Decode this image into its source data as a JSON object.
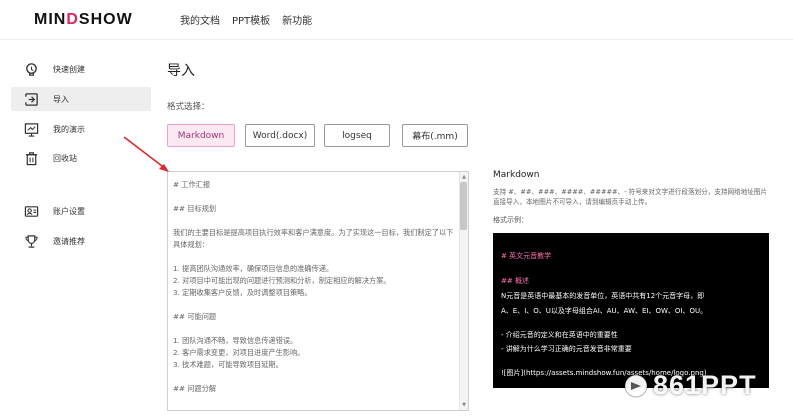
{
  "app": {
    "logo_prefix": "MIN",
    "logo_accent": "D",
    "logo_suffix": "SHOW",
    "accent_color": "#e0245e"
  },
  "topnav": {
    "items": [
      "我的文档",
      "PPT模板",
      "新功能"
    ]
  },
  "sidebar": {
    "items": [
      {
        "label": "快速创建",
        "icon": "lightbulb-icon"
      },
      {
        "label": "导入",
        "icon": "import-icon",
        "active": true
      },
      {
        "label": "我的演示",
        "icon": "presentation-icon"
      },
      {
        "label": "回收站",
        "icon": "trash-icon"
      },
      {
        "label": "账户设置",
        "icon": "account-icon"
      },
      {
        "label": "邀请推荐",
        "icon": "trophy-icon"
      }
    ]
  },
  "main": {
    "title": "导入",
    "format_label": "格式选择：",
    "formats": [
      "Markdown",
      "Word(.docx)",
      "logseq",
      "幕布(.mm)"
    ],
    "active_format": "Markdown",
    "editor_text": "# 工作汇报\n\n## 目标规划\n\n我们的主要目标是提高项目执行效率和客户满意度。为了实现这一目标，我们制定了以下具体规划：\n\n1. 提高团队沟通效率，确保项目信息的准确传递。\n2. 对项目中可能出现的问题进行预测和分析，制定相应的解决方案。\n3. 定期收集客户反馈，及时调整项目策略。\n\n## 可能问题\n\n1. 团队沟通不畅，导致信息传递错误。\n2. 客户需求变更，对项目进度产生影响。\n3. 技术难题，可能导致项目延期。\n\n## 问题分解"
  },
  "preview": {
    "title": "Markdown",
    "description": "支持 #、##、###、####、#####、- 符号来对文字进行段落划分，支持网络地址图片直接导入，本地图片不可导入，请到编辑页手动上传。",
    "example_label": "格式示例：",
    "example_lines": [
      {
        "text": "# 英文元音教学",
        "style": "heading"
      },
      {
        "text": "## 概述",
        "style": "heading"
      },
      {
        "text": "N元音是英语中最基本的发音单位，英语中共有12个元音字母，即",
        "style": "plain"
      },
      {
        "text": "A、E、I、O、U以及字母组合AI、AU、AW、EI、OW、OI、OU。",
        "style": "plain"
      },
      {
        "text": "- 介绍元音的定义和在英语中的重要性",
        "style": "plain"
      },
      {
        "text": "- 讲解为什么学习正确的元音发音非常重要",
        "style": "plain"
      },
      {
        "text": "![图片](https://assets.mindshow.fun/assets/home/logo.png)",
        "style": "plain"
      }
    ]
  },
  "watermark": {
    "text": "861PPT"
  }
}
